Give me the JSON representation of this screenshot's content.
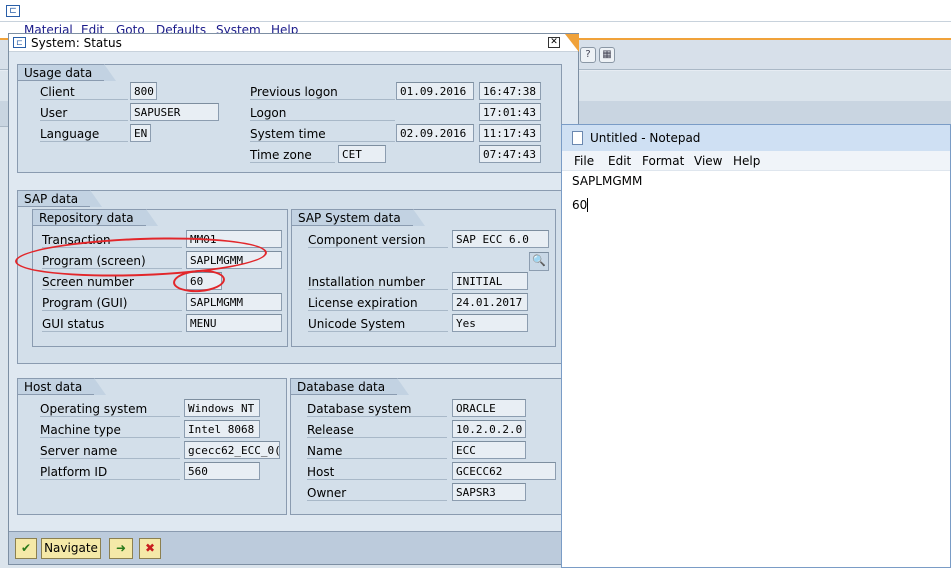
{
  "sap_main": {
    "menu": [
      "Material",
      "Edit",
      "Goto",
      "Defaults",
      "System",
      "Help"
    ]
  },
  "dialog": {
    "title": "System: Status",
    "usage": {
      "title": "Usage data",
      "client_label": "Client",
      "client": "800",
      "user_label": "User",
      "user": "SAPUSER",
      "language_label": "Language",
      "language": "EN",
      "prev_logon_label": "Previous logon",
      "prev_logon_date": "01.09.2016",
      "prev_logon_time": "16:47:38",
      "logon_label": "Logon",
      "logon_time": "17:01:43",
      "system_time_label": "System time",
      "system_date": "02.09.2016",
      "system_time": "11:17:43",
      "time_zone_label": "Time zone",
      "time_zone": "CET",
      "time_zone_time": "07:47:43"
    },
    "sap": {
      "title": "SAP data",
      "repo": {
        "title": "Repository data",
        "transaction_label": "Transaction",
        "transaction": "MM01",
        "program_screen_label": "Program (screen)",
        "program_screen": "SAPLMGMM",
        "screen_number_label": "Screen number",
        "screen_number": "60",
        "program_gui_label": "Program (GUI)",
        "program_gui": "SAPLMGMM",
        "gui_status_label": "GUI status",
        "gui_status": "MENU"
      },
      "system": {
        "title": "SAP System data",
        "component_label": "Component version",
        "component": "SAP ECC 6.0",
        "installation_label": "Installation number",
        "installation": "INITIAL",
        "license_label": "License expiration",
        "license": "24.01.2017",
        "unicode_label": "Unicode System",
        "unicode": "Yes"
      }
    },
    "host": {
      "title": "Host data",
      "os_label": "Operating system",
      "os": "Windows NT",
      "machine_label": "Machine type",
      "machine": "Intel 8068",
      "server_label": "Server name",
      "server": "gcecc62_ECC_0(",
      "platform_label": "Platform ID",
      "platform": "560"
    },
    "db": {
      "title": "Database data",
      "dbsys_label": "Database system",
      "dbsys": "ORACLE",
      "release_label": "Release",
      "release": "10.2.0.2.0",
      "name_label": "Name",
      "name": "ECC",
      "host_label": "Host",
      "host": "GCECC62",
      "owner_label": "Owner",
      "owner": "SAPSR3"
    },
    "footer": {
      "navigate_label": "Navigate"
    }
  },
  "notepad": {
    "title": "Untitled - Notepad",
    "menu": [
      "File",
      "Edit",
      "Format",
      "View",
      "Help"
    ],
    "lines": [
      "SAPLMGMM",
      "60"
    ]
  },
  "colors": {
    "highlight_circle": "#e2262a",
    "sap_accent": "#f0a23a"
  },
  "icons": [
    "sap-window-icon",
    "close-icon",
    "check-icon",
    "navigate-icon",
    "cancel-icon",
    "detail-search-icon",
    "notepad-icon"
  ]
}
